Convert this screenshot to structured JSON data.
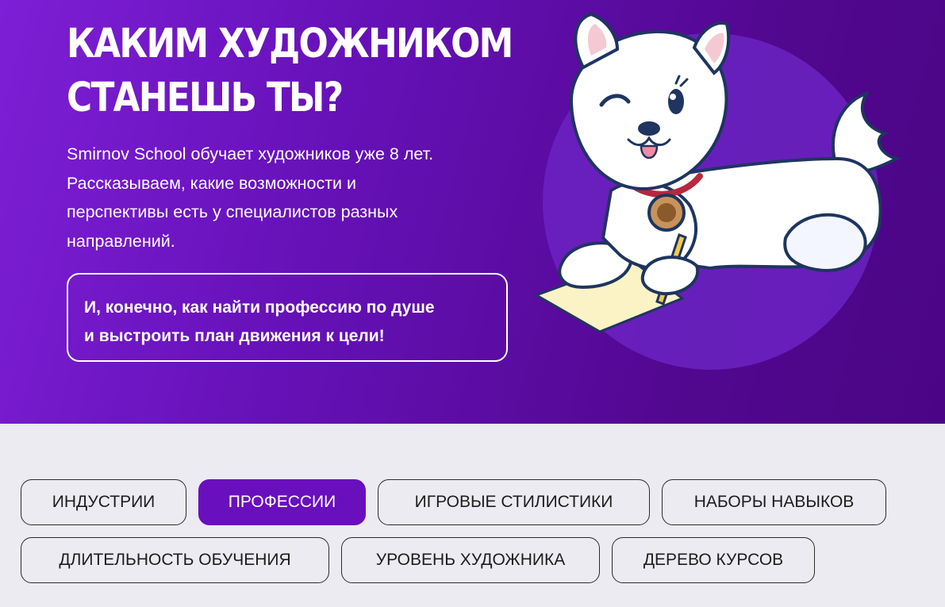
{
  "hero": {
    "title_lines": [
      "КАКИМ ХУДОЖНИКОМ",
      "СТАНЕШЬ ТЫ?"
    ],
    "description_lines": [
      "Smirnov School обучает художников уже 8 лет.",
      "Рассказываем, какие возможности и",
      "перспективы есть у специалистов разных",
      "направлений."
    ],
    "callout_lines": [
      "И, конечно, как найти профессию по душе",
      "и выстроить план движения к цели!"
    ],
    "illustration_icon": "white-puppy-drawing-icon"
  },
  "tabs": [
    {
      "label": "ИНДУСТРИИ",
      "active": false
    },
    {
      "label": "ПРОФЕССИИ",
      "active": true
    },
    {
      "label": "ИГРОВЫЕ СТИЛИСТИКИ",
      "active": false
    },
    {
      "label": "НАБОРЫ НАВЫКОВ",
      "active": false
    },
    {
      "label": "ДЛИТЕЛЬНОСТЬ ОБУЧЕНИЯ",
      "active": false
    },
    {
      "label": "УРОВЕНЬ ХУДОЖНИКА",
      "active": false
    },
    {
      "label": "ДЕРЕВО КУРСОВ",
      "active": false
    }
  ],
  "colors": {
    "hero_bg_start": "#7d1fd6",
    "hero_bg_end": "#4a0585",
    "accent": "#6a0fbd",
    "page_bg": "#ecebf2"
  }
}
